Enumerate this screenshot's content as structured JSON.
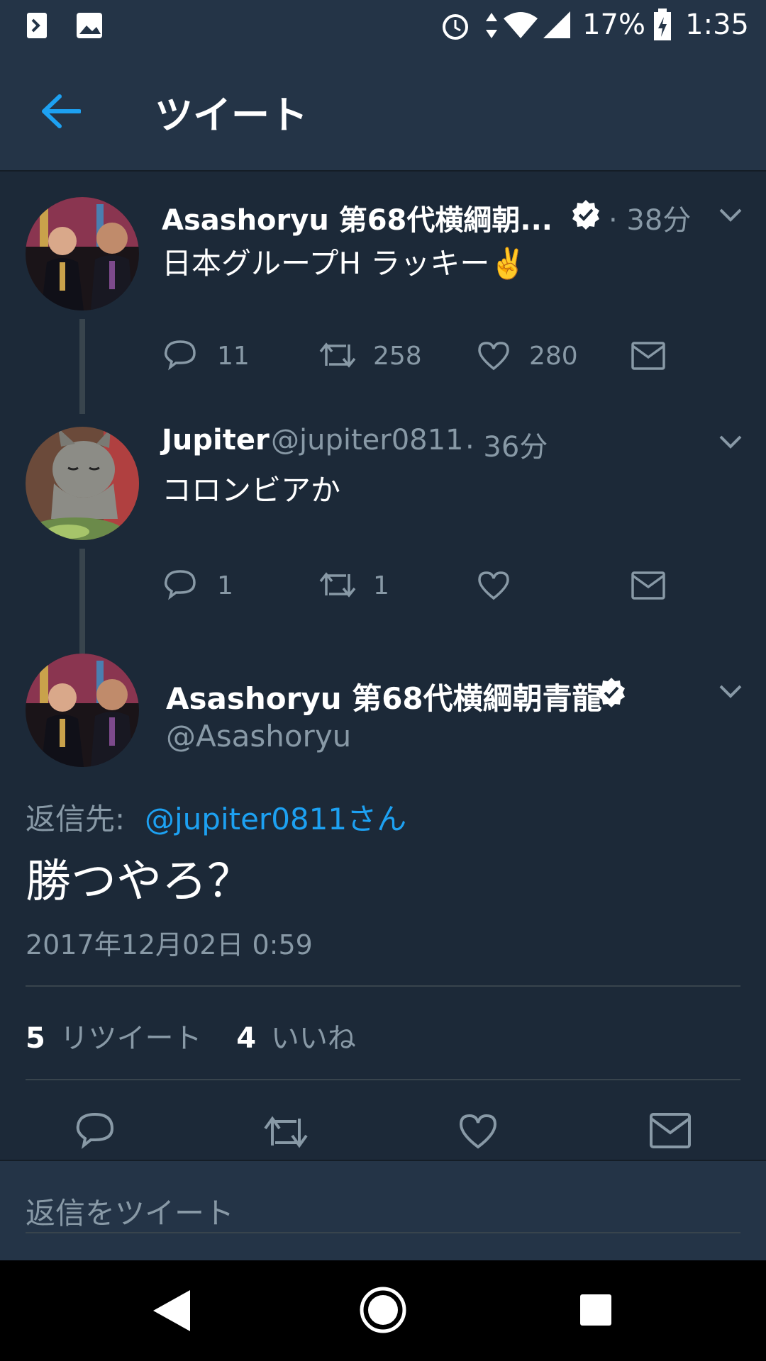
{
  "status_bar": {
    "battery": "17%",
    "time": "1:35"
  },
  "header": {
    "title": "ツイート"
  },
  "tweets": [
    {
      "name": "Asashoryu 第68代横綱朝...",
      "time": "· 38分",
      "text": "日本グループH ラッキー",
      "emoji": "✌️",
      "replies": "11",
      "retweets": "258",
      "likes": "280"
    },
    {
      "name": "Jupiter",
      "handle": "@jupiter0811",
      "time": "· 36分",
      "text": "コロンビアか",
      "replies": "1",
      "retweets": "1",
      "likes": ""
    }
  ],
  "main_tweet": {
    "name": "Asashoryu 第68代横綱朝青龍",
    "handle": "@Asashoryu",
    "reply_prefix": "返信先:",
    "reply_to": "@jupiter0811さん",
    "text": "勝つやろ？",
    "timestamp": "2017年12月02日 0:59",
    "retweet_count": "5",
    "retweet_label": "リツイート",
    "like_count": "4",
    "like_label": "いいね"
  },
  "reply_input": {
    "placeholder": "返信をツイート"
  },
  "colors": {
    "background": "#1c2938",
    "bar": "#243447",
    "accent": "#1da1f2",
    "muted": "#8899a6"
  }
}
